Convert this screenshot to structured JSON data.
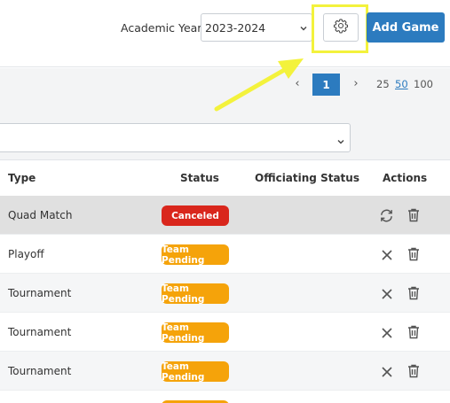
{
  "header": {
    "academic_year_label": "Academic Year:",
    "academic_year_value": "2023-2024",
    "add_game_label": "Add Game",
    "primary_color": "#2c7bbf",
    "highlight_color": "#f3f23c"
  },
  "pagination": {
    "prev_symbol": "‹",
    "current_page": "1",
    "next_symbol": "›",
    "page_sizes": [
      "25",
      "50",
      "100"
    ],
    "selected_page_size": "50"
  },
  "filter": {
    "value": ""
  },
  "table": {
    "headers": {
      "type": "Type",
      "status": "Status",
      "officiating_status": "Officiating Status",
      "actions": "Actions"
    },
    "rows": [
      {
        "type": "Quad Match",
        "status": "Canceled",
        "status_color": "#d9261c",
        "officiating_status": "",
        "primary_action": "refresh-icon"
      },
      {
        "type": "Playoff",
        "status": "Team Pending",
        "status_color": "#f5a30a",
        "officiating_status": "",
        "primary_action": "close-icon"
      },
      {
        "type": "Tournament",
        "status": "Team Pending",
        "status_color": "#f5a30a",
        "officiating_status": "",
        "primary_action": "close-icon"
      },
      {
        "type": "Tournament",
        "status": "Team Pending",
        "status_color": "#f5a30a",
        "officiating_status": "",
        "primary_action": "close-icon"
      },
      {
        "type": "Tournament",
        "status": "Team Pending",
        "status_color": "#f5a30a",
        "officiating_status": "",
        "primary_action": "close-icon"
      }
    ]
  }
}
